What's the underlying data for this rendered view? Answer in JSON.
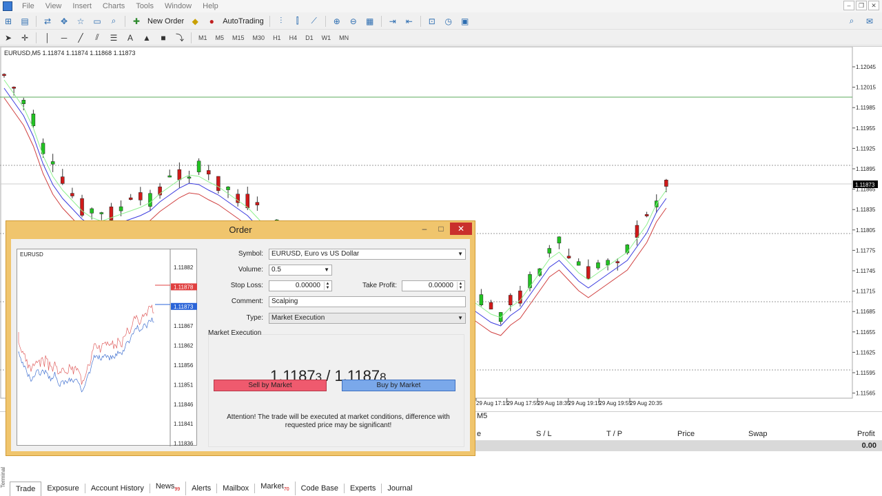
{
  "menu": {
    "items": [
      "File",
      "View",
      "Insert",
      "Charts",
      "Tools",
      "Window",
      "Help"
    ]
  },
  "toolbar": {
    "new_order_label": "New Order",
    "autotrading_label": "AutoTrading",
    "timeframes": [
      "M1",
      "M5",
      "M15",
      "M30",
      "H1",
      "H4",
      "D1",
      "W1",
      "MN"
    ]
  },
  "chart": {
    "header": "EURUSD,M5  1.11874 1.11874 1.11868 1.11873",
    "price_labels": [
      "1.12045",
      "1.12015",
      "1.11985",
      "1.11955",
      "1.11925",
      "1.11895",
      "1.11873",
      "1.11865",
      "1.11835",
      "1.11805",
      "1.11775",
      "1.11745",
      "1.11715",
      "1.11685",
      "1.11655",
      "1.11625",
      "1.11595",
      "1.11565"
    ],
    "current_price": "1.11873",
    "time_labels": [
      "29 Aug 17:15",
      "29 Aug 17:55",
      "29 Aug 18:35",
      "29 Aug 19:15",
      "29 Aug 19:55",
      "29 Aug 20:35"
    ],
    "colors": {
      "bull": "#22c322",
      "bear": "#d01a1a",
      "ma_fast": "#8ef08e",
      "ma_mid": "#3a3adf",
      "ma_slow": "#d04040"
    }
  },
  "terminal": {
    "side_label": "Terminal",
    "columns": {
      "sl": "S / L",
      "tp": "T / P",
      "price": "Price",
      "swap": "Swap",
      "profit": "Profit"
    },
    "left_col_fragment": "e",
    "tab_fragment": "M5",
    "total_profit": "0.00",
    "tabs": [
      {
        "label": "Trade",
        "badge": ""
      },
      {
        "label": "Exposure",
        "badge": ""
      },
      {
        "label": "Account History",
        "badge": ""
      },
      {
        "label": "News",
        "badge": "99"
      },
      {
        "label": "Alerts",
        "badge": ""
      },
      {
        "label": "Mailbox",
        "badge": ""
      },
      {
        "label": "Market",
        "badge": "70"
      },
      {
        "label": "Code Base",
        "badge": ""
      },
      {
        "label": "Experts",
        "badge": ""
      },
      {
        "label": "Journal",
        "badge": ""
      }
    ]
  },
  "order": {
    "title": "Order",
    "mini_chart_symbol": "EURUSD",
    "mini_prices": [
      "1.11882",
      "1.11878",
      "1.11873",
      "1.11867",
      "1.11862",
      "1.11856",
      "1.11851",
      "1.11846",
      "1.11841",
      "1.11836"
    ],
    "symbol_label": "Symbol:",
    "symbol_value": "EURUSD, Euro vs US Dollar",
    "volume_label": "Volume:",
    "volume_value": "0.5",
    "stoploss_label": "Stop Loss:",
    "stoploss_value": "0.00000",
    "takeprofit_label": "Take Profit:",
    "takeprofit_value": "0.00000",
    "comment_label": "Comment:",
    "comment_value": "Scalping",
    "type_label": "Type:",
    "type_value": "Market Execution",
    "market_execution_label": "Market Execution",
    "bid_main": "1.1187",
    "bid_small": "3",
    "price_separator": " / ",
    "ask_main": "1.1187",
    "ask_small": "8",
    "sell_label": "Sell by Market",
    "buy_label": "Buy by Market",
    "attention": "Attention! The trade will be executed at market conditions, difference with requested price may be significant!"
  }
}
